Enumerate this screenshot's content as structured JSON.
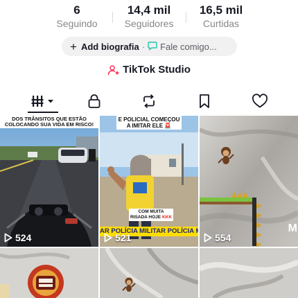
{
  "stats": [
    {
      "value": "6",
      "label": "Seguindo"
    },
    {
      "value": "14,4 mil",
      "label": "Seguidores"
    },
    {
      "value": "16,5 mil",
      "label": "Curtidas"
    }
  ],
  "bio": {
    "add_label": "Add biografia",
    "separator": "·",
    "message": "Fale comigo..."
  },
  "studio": {
    "label": "TikTok Studio"
  },
  "tabs": [
    {
      "name": "videos-grid",
      "icon": "grid-icon",
      "active": true
    },
    {
      "name": "private",
      "icon": "lock-icon"
    },
    {
      "name": "reposts",
      "icon": "repost-icon"
    },
    {
      "name": "favorites",
      "icon": "bookmark-icon"
    },
    {
      "name": "liked",
      "icon": "heart-icon"
    }
  ],
  "videos": [
    {
      "views": "524",
      "caption": "DOS TRÂNSITOS QUE ESTÃO COLOCANDO SUA VIDA EM RISCO!"
    },
    {
      "views": "521",
      "caption": "E POLICIAL COMEÇOU A IMITAR ELE 🚨",
      "overlay_text": "COM MUITA",
      "overlay_text2": "RISADA HOJE",
      "overlay_accent": "KKK",
      "ticker": "AR  POLÍCIA MILITAR  POLÍCIA MIL"
    },
    {
      "views": "554",
      "side_text": "M"
    },
    {
      "views": ""
    },
    {
      "views": ""
    },
    {
      "views": ""
    }
  ],
  "colors": {
    "text_primary": "#161823",
    "text_secondary": "#86878b",
    "pill_bg": "#f1f1f2",
    "studio_icon": "#fe2c55",
    "ticker_bg": "#ffdd00"
  }
}
